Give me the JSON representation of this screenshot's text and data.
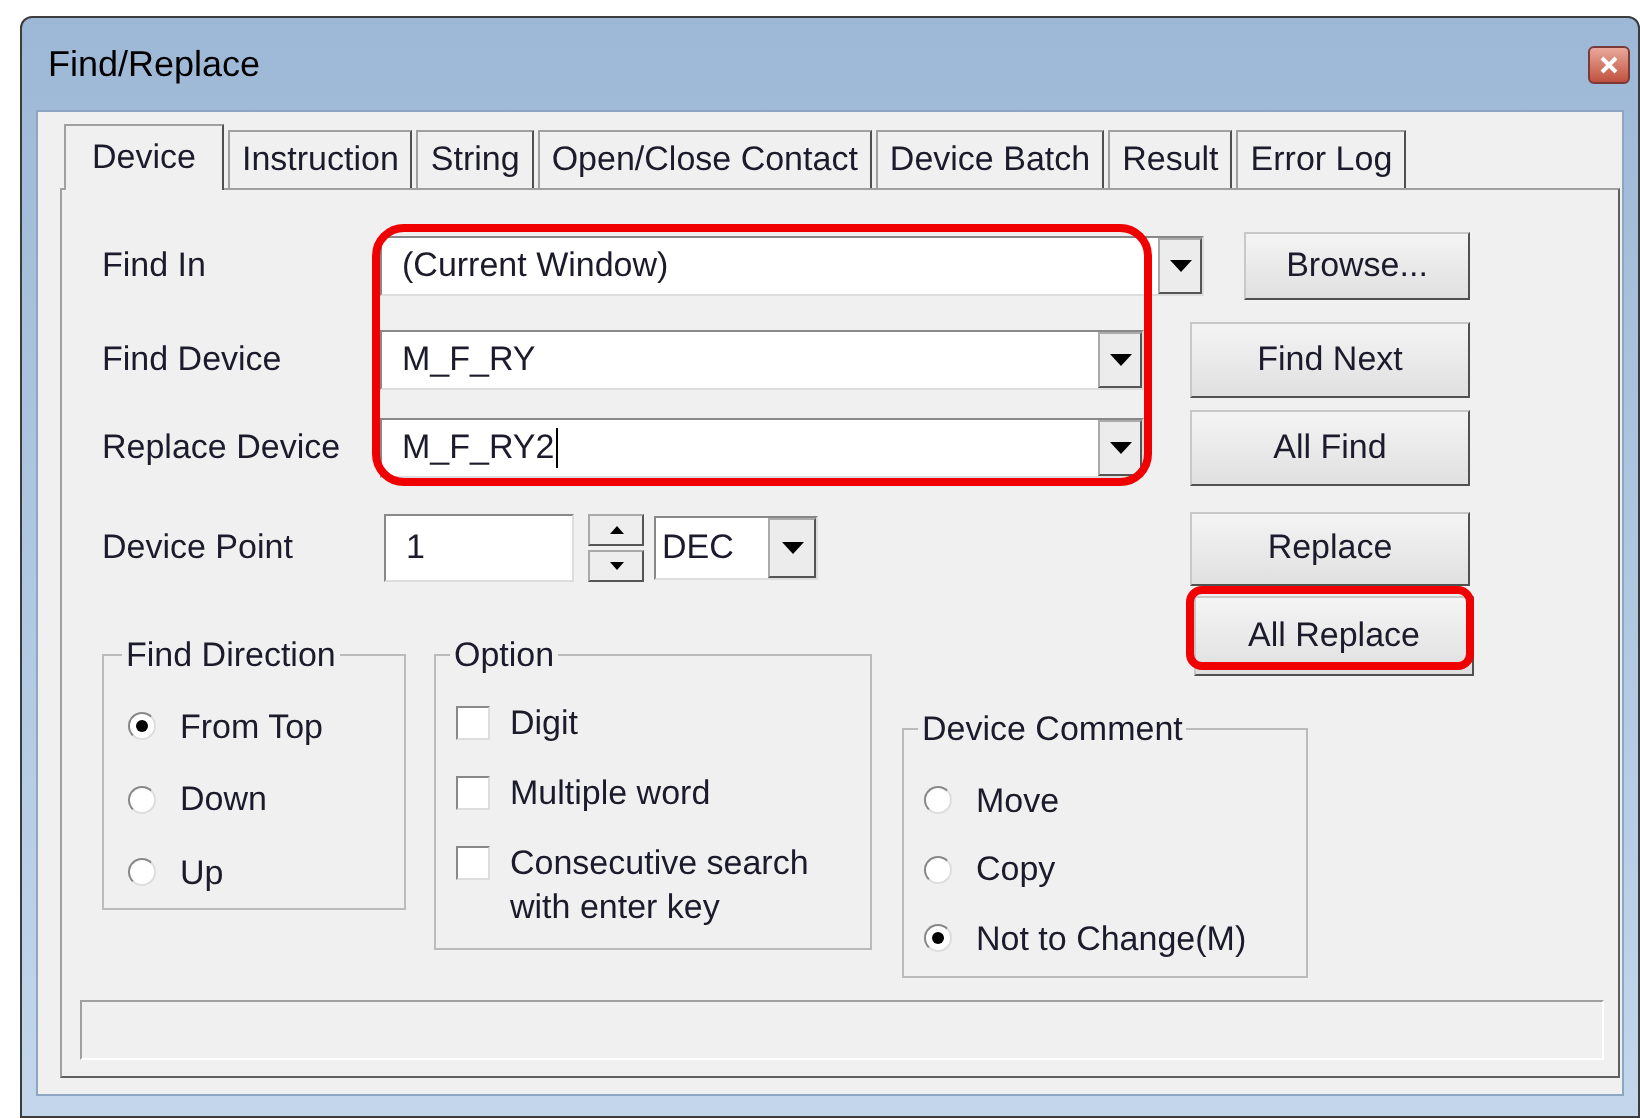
{
  "window": {
    "title": "Find/Replace"
  },
  "tabs": [
    {
      "label": "Device",
      "selected": true
    },
    {
      "label": "Instruction",
      "selected": false
    },
    {
      "label": "String",
      "selected": false
    },
    {
      "label": "Open/Close Contact",
      "selected": false
    },
    {
      "label": "Device Batch",
      "selected": false
    },
    {
      "label": "Result",
      "selected": false
    },
    {
      "label": "Error Log",
      "selected": false
    }
  ],
  "find_in": {
    "label": "Find In",
    "value": "(Current Window)",
    "focused": false
  },
  "find_device": {
    "label": "Find Device",
    "value": "M_F_RY",
    "focused": false
  },
  "replace_device": {
    "label": "Replace Device",
    "value": "M_F_RY2",
    "focused": true
  },
  "device_point": {
    "label": "Device Point",
    "value": "1",
    "radix": "DEC"
  },
  "buttons": [
    {
      "label": "Browse..."
    },
    {
      "label": "Find Next"
    },
    {
      "label": "All Find"
    },
    {
      "label": "Replace"
    },
    {
      "label": "All Replace"
    }
  ],
  "find_direction": {
    "title": "Find Direction",
    "options": [
      {
        "label": "From Top",
        "selected": true
      },
      {
        "label": "Down",
        "selected": false
      },
      {
        "label": "Up",
        "selected": false
      }
    ]
  },
  "option": {
    "title": "Option",
    "options": [
      {
        "label": "Digit",
        "checked": false
      },
      {
        "label": "Multiple word",
        "checked": false
      },
      {
        "label": "Consecutive search with enter key",
        "checked": false
      }
    ]
  },
  "device_comment": {
    "title": "Device Comment",
    "options": [
      {
        "label": "Move",
        "selected": false
      },
      {
        "label": "Copy",
        "selected": false
      },
      {
        "label": "Not to Change(M)",
        "selected": true
      }
    ]
  }
}
